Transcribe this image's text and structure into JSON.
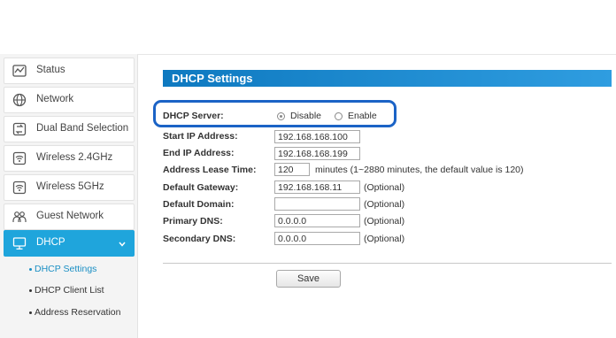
{
  "sidebar": {
    "items": [
      {
        "label": "Status",
        "icon": "status-chart-icon"
      },
      {
        "label": "Network",
        "icon": "globe-icon"
      },
      {
        "label": "Dual Band Selection",
        "icon": "dual-band-icon"
      },
      {
        "label": "Wireless 2.4GHz",
        "icon": "wifi-icon"
      },
      {
        "label": "Wireless 5GHz",
        "icon": "wifi-icon"
      },
      {
        "label": "Guest Network",
        "icon": "guest-network-icon"
      },
      {
        "label": "DHCP",
        "icon": "monitor-icon",
        "active": true
      }
    ],
    "subitems": [
      {
        "label": "DHCP Settings",
        "selected": true
      },
      {
        "label": "DHCP Client List"
      },
      {
        "label": "Address Reservation"
      }
    ],
    "active_color": "#1fa5dc"
  },
  "section": {
    "title": "DHCP Settings",
    "header_color": "#1a84cc"
  },
  "form": {
    "dhcp_server": {
      "label": "DHCP Server:",
      "options": [
        "Disable",
        "Enable"
      ],
      "selected": "Disable"
    },
    "start_ip": {
      "label": "Start IP Address:",
      "value": "192.168.168.100"
    },
    "end_ip": {
      "label": "End IP Address:",
      "value": "192.168.168.199"
    },
    "lease_time": {
      "label": "Address Lease Time:",
      "value": "120",
      "hint": "minutes (1~2880 minutes, the default value is 120)"
    },
    "gateway": {
      "label": "Default Gateway:",
      "value": "192.168.168.11",
      "hint": "(Optional)"
    },
    "domain": {
      "label": "Default Domain:",
      "value": "",
      "hint": "(Optional)"
    },
    "primary_dns": {
      "label": "Primary DNS:",
      "value": "0.0.0.0",
      "hint": "(Optional)"
    },
    "secondary_dns": {
      "label": "Secondary DNS:",
      "value": "0.0.0.0",
      "hint": "(Optional)"
    }
  },
  "actions": {
    "save_label": "Save"
  },
  "highlight_color": "#1b63c6"
}
